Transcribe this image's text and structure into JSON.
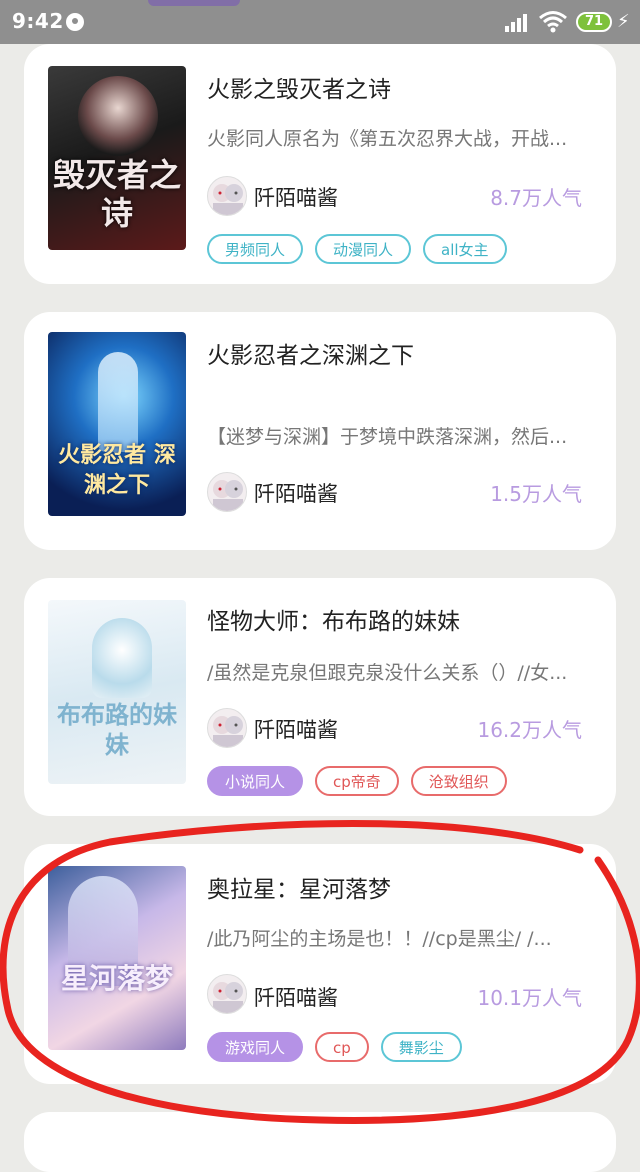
{
  "status": {
    "time": "9:42",
    "battery": "71"
  },
  "books": [
    {
      "title": "火影之毁灭者之诗",
      "desc": "火影同人原名为《第五次忍界大战，开战...",
      "author": "阡陌喵酱",
      "popularity": "8.7万人气",
      "cover_text": "毁灭者之诗",
      "tags": [
        {
          "label": "男频同人",
          "style": "teal"
        },
        {
          "label": "动漫同人",
          "style": "teal"
        },
        {
          "label": "all女主",
          "style": "teal"
        }
      ]
    },
    {
      "title": "火影忍者之深渊之下",
      "desc": "【迷梦与深渊】于梦境中跌落深渊，然后...",
      "author": "阡陌喵酱",
      "popularity": "1.5万人气",
      "cover_text": "火影忍者 深渊之下",
      "tags": []
    },
    {
      "title": "怪物大师：布布路的妹妹",
      "desc": "/虽然是克泉但跟克泉没什么关系（）//女...",
      "author": "阡陌喵酱",
      "popularity": "16.2万人气",
      "cover_text": "布布路的妹妹",
      "tags": [
        {
          "label": "小说同人",
          "style": "purple"
        },
        {
          "label": "cp帝奇",
          "style": "red"
        },
        {
          "label": "沧致组织",
          "style": "red"
        }
      ]
    },
    {
      "title": "奥拉星：星河落梦",
      "desc": "/此乃阿尘的主场是也！！//cp是黑尘/ /...",
      "author": "阡陌喵酱",
      "popularity": "10.1万人气",
      "cover_text": "星河落梦",
      "tags": [
        {
          "label": "游戏同人",
          "style": "purple"
        },
        {
          "label": "cp",
          "style": "red"
        },
        {
          "label": "舞影尘",
          "style": "teal"
        }
      ]
    }
  ],
  "colors": {
    "accent_purple": "#b592e6",
    "accent_teal": "#5cc6d6",
    "accent_red": "#e86b6b",
    "annotation_red": "#e8241f"
  },
  "icons": [
    "message-icon",
    "signal-icon",
    "wifi-icon",
    "battery-icon",
    "charging-icon",
    "avatar-icon"
  ]
}
